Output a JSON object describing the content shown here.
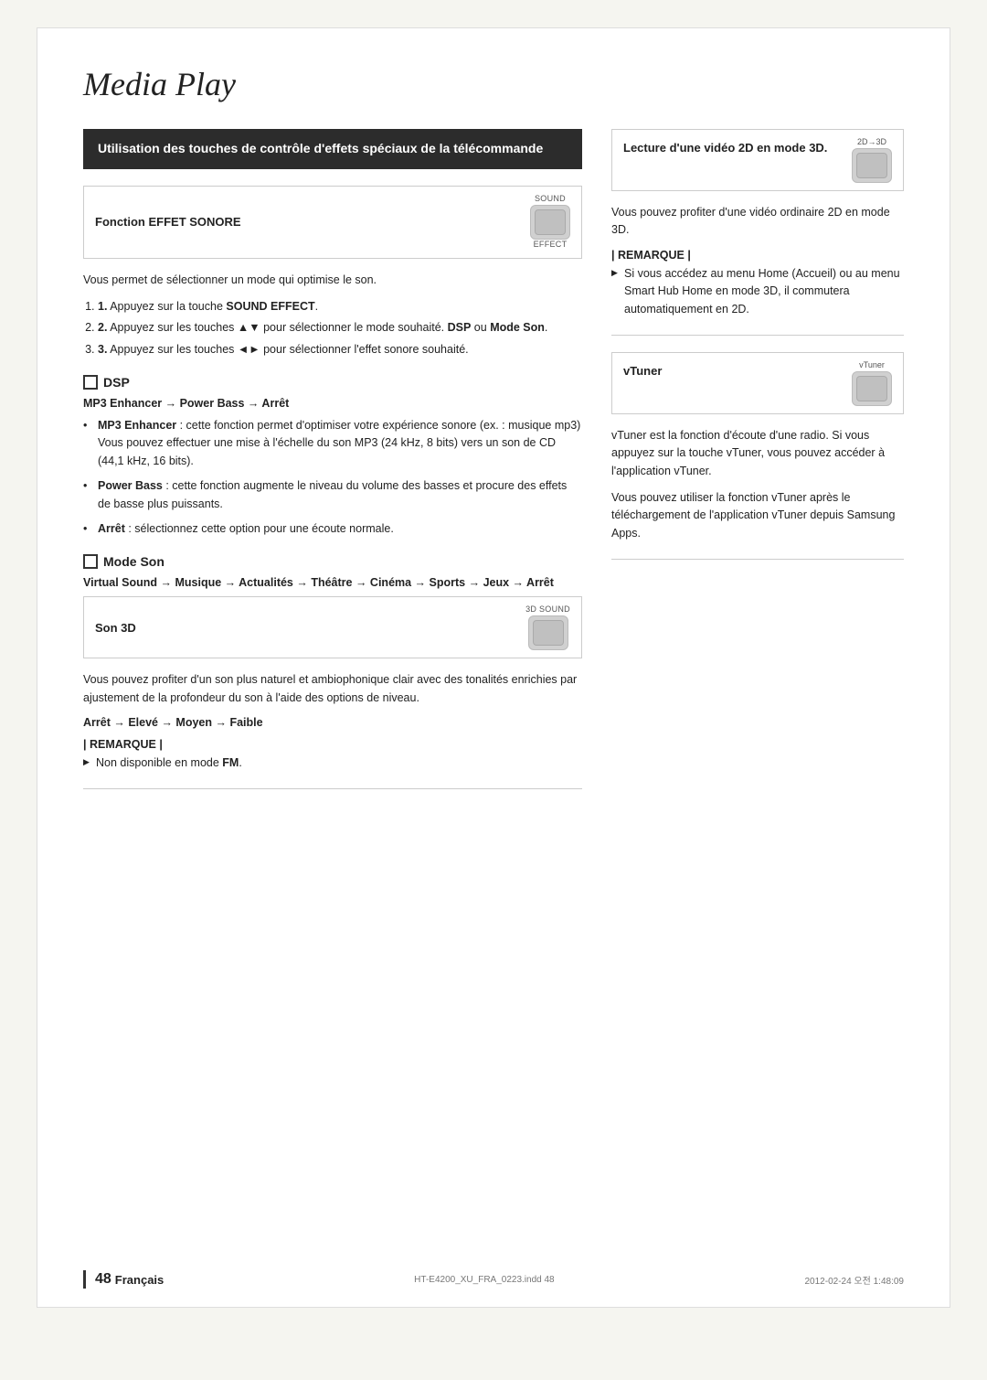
{
  "page": {
    "title": "Media Play",
    "background": "#fff"
  },
  "left_col": {
    "section_header": "Utilisation des touches de contrôle d'effets spéciaux de la télécommande",
    "function_row": {
      "label": "Fonction EFFET SONORE",
      "button_top_label": "SOUND",
      "button_bottom_label": "EFFECT"
    },
    "body_text1": "Vous permet de sélectionner un mode qui optimise le son.",
    "steps": [
      "Appuyez sur la touche SOUND EFFECT.",
      "Appuyez sur les touches ▲▼ pour sélectionner le mode souhaité. DSP ou Mode Son.",
      "Appuyez sur les touches ◄► pour sélectionner l'effet sonore souhaité."
    ],
    "dsp": {
      "title": "DSP",
      "arrow_chain": "MP3 Enhancer → Power Bass → Arrêt",
      "bullets": [
        {
          "term": "MP3 Enhancer",
          "text": ": cette fonction permet d'optimiser votre expérience sonore (ex. : musique mp3) Vous pouvez effectuer une mise à l'échelle du son MP3 (24 kHz, 8 bits) vers un son de CD (44,1 kHz, 16 bits)."
        },
        {
          "term": "Power Bass",
          "text": ": cette fonction augmente le niveau du volume des basses et procure des effets de basse plus puissants."
        },
        {
          "term": "Arrêt",
          "text": " : sélectionnez cette option pour une écoute normale."
        }
      ]
    },
    "mode_son": {
      "title": "Mode Son",
      "arrow_chain": "Virtual Sound → Musique → Actualités → Théâtre → Cinéma → Sports → Jeux → Arrêt"
    },
    "son_3d": {
      "label": "Son 3D",
      "button_top_label": "3D SOUND"
    },
    "son_3d_body": "Vous pouvez profiter d'un son plus naturel et ambiophonique clair avec des tonalités enrichies par ajustement de la profondeur du son à l'aide des options de niveau.",
    "son_3d_arrow": "Arrêt → Elevé → Moyen → Faible",
    "remarque_title": "| REMARQUE |",
    "remarque_item": "Non disponible en mode FM."
  },
  "right_col": {
    "lecture_2d_3d": {
      "label": "Lecture d'une vidéo 2D en mode 3D.",
      "button_top_label": "2D→3D"
    },
    "lecture_body": "Vous pouvez profiter d'une vidéo ordinaire 2D en mode 3D.",
    "remarque_title": "| REMARQUE |",
    "remarque_item": "Si vous accédez au menu Home (Accueil) ou au menu Smart Hub Home en mode 3D, il commutera automatiquement en 2D.",
    "vtuner": {
      "label": "vTuner",
      "button_top_label": "vTuner"
    },
    "vtuner_body1": "vTuner est la fonction d'écoute d'une radio. Si vous appuyez sur la touche vTuner, vous pouvez accéder à l'application vTuner.",
    "vtuner_body2": "Vous pouvez utiliser la fonction vTuner après le téléchargement de l'application vTuner depuis Samsung Apps."
  },
  "footer": {
    "page_number": "48",
    "language": "Français",
    "file": "HT-E4200_XU_FRA_0223.indd   48",
    "date": "2012-02-24   오전 1:48:09"
  }
}
